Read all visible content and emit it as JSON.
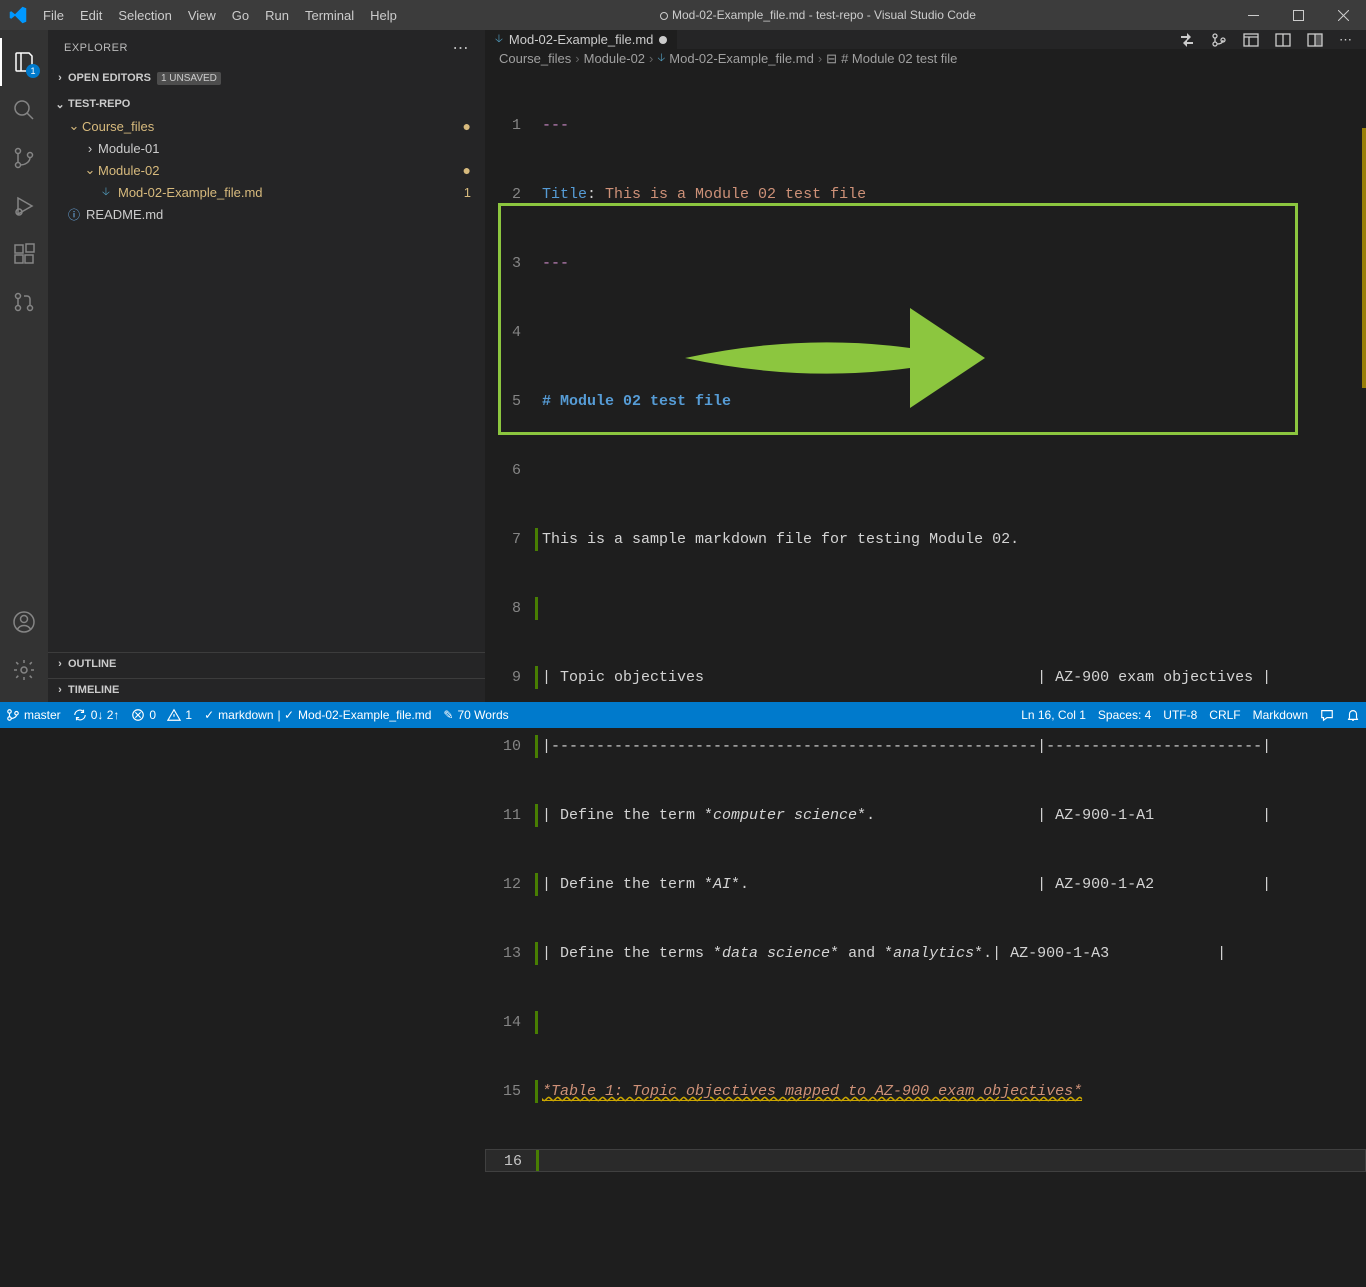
{
  "window": {
    "title": "Mod-02-Example_file.md - test-repo - Visual Studio Code"
  },
  "menu": [
    "File",
    "Edit",
    "Selection",
    "View",
    "Go",
    "Run",
    "Terminal",
    "Help"
  ],
  "activitybar": {
    "explorer_badge": "1"
  },
  "explorer": {
    "title": "EXPLORER",
    "open_editors": "OPEN EDITORS",
    "unsaved": "1 UNSAVED",
    "repo": "TEST-REPO",
    "folders": {
      "course": "Course_files",
      "mod1": "Module-01",
      "mod2": "Module-02",
      "file_md": "Mod-02-Example_file.md",
      "file_md_num": "1",
      "readme": "README.md"
    },
    "outline": "OUTLINE",
    "timeline": "TIMELINE"
  },
  "tab": {
    "name": "Mod-02-Example_file.md"
  },
  "breadcrumb": {
    "p1": "Course_files",
    "p2": "Module-02",
    "p3": "Mod-02-Example_file.md",
    "p4": "# Module 02 test file"
  },
  "code": {
    "l1": "---",
    "l2a": "Title",
    "l2b": ": ",
    "l2c": "This is a Module 02 test file",
    "l3": "---",
    "l5": "# Module 02 test file",
    "l7": "This is a sample markdown file for testing Module 02.",
    "l9": "| Topic objectives                                     | AZ-900 exam objectives |",
    "l10": "|------------------------------------------------------|------------------------|",
    "l11a": "| Define the term *",
    "l11b": "computer science",
    "l11c": "*.                  | AZ-900-1-A1            |",
    "l12a": "| Define the term *",
    "l12b": "AI",
    "l12c": "*.                                | AZ-900-1-A2            |",
    "l13a": "| Define the terms *",
    "l13b": "data science",
    "l13c": "* and *",
    "l13d": "analytics",
    "l13e": "*.| AZ-900-1-A3            |",
    "l15": "*Table 1: Topic objectives mapped to AZ-900 exam objectives*"
  },
  "status": {
    "branch": "master",
    "sync": "0↓ 2↑",
    "errors": "0",
    "warnings": "1",
    "lint": "markdown",
    "file": "Mod-02-Example_file.md",
    "words": "70 Words",
    "lncol": "Ln 16, Col 1",
    "spaces": "Spaces: 4",
    "enc": "UTF-8",
    "eol": "CRLF",
    "lang": "Markdown"
  }
}
